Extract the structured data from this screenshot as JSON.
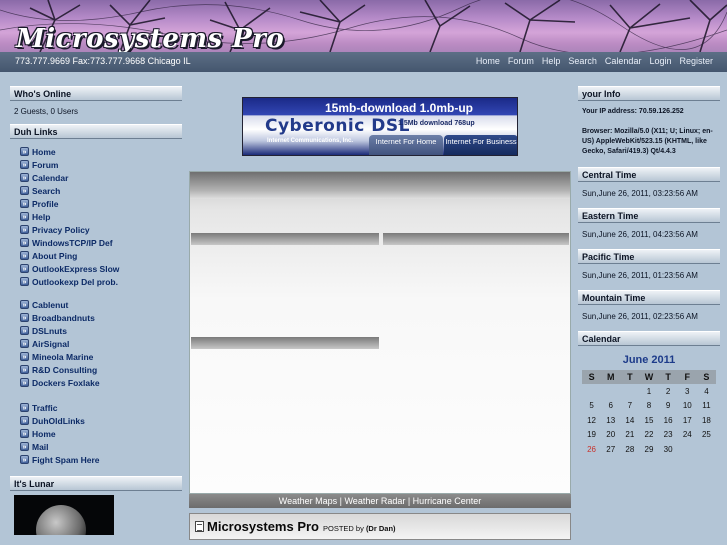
{
  "header": {
    "title": "Microsystems Pro",
    "contact": "773.777.9669 Fax:773.777.9668 Chicago IL",
    "nav": [
      "Home",
      "Forum",
      "Help",
      "Search",
      "Calendar",
      "Login",
      "Register"
    ]
  },
  "left": {
    "whos_online": {
      "title": "Who's Online",
      "text": "2 Guests, 0 Users"
    },
    "links_title": "Duh Links",
    "links_group1": [
      "Home",
      "Forum",
      "Calendar",
      "Search",
      "Profile",
      "Help",
      "Privacy Policy",
      "WindowsTCP/IP Def",
      "About Ping",
      "OutlookExpress Slow",
      "Outlookexp Del prob."
    ],
    "links_group2": [
      "Cablenut",
      "Broadbandnuts",
      "DSLnuts",
      "AirSignal",
      "Mineola Marine",
      "R&D Consulting",
      "Dockers Foxlake"
    ],
    "links_group3": [
      "Traffic",
      "DuhOldLinks",
      "Home",
      "Mail",
      "Fight Spam Here"
    ],
    "lunar_title": "It's Lunar"
  },
  "banner": {
    "line1": "15mb-download 1.0mb-up",
    "brand": "Cyberonic DSL",
    "speed": "1.5Mb download 768up",
    "company": "Internet Communications, Inc.",
    "btn_home": "Internet For Home",
    "btn_business": "Internet For Business"
  },
  "center": {
    "weather_links": "Weather Maps | Weather Radar | Hurricane Center",
    "story_title": "Microsystems Pro",
    "posted_label": "POSTED by",
    "author": "(Dr Dan)"
  },
  "right": {
    "info_title": "your Info",
    "ip": "Your IP address: 70.59.126.252",
    "browser": "Browser: Mozilla/5.0 (X11; U; Linux; en-US) AppleWebKit/523.15 (KHTML, like Gecko, Safari/419.3) Qt/4.4.3",
    "times": [
      {
        "title": "Central Time",
        "value": "Sun,June 26, 2011, 03:23:56 AM"
      },
      {
        "title": "Eastern Time",
        "value": "Sun,June 26, 2011, 04:23:56 AM"
      },
      {
        "title": "Pacific Time",
        "value": "Sun,June 26, 2011, 01:23:56 AM"
      },
      {
        "title": "Mountain Time",
        "value": "Sun,June 26, 2011, 02:23:56 AM"
      }
    ],
    "calendar_title": "Calendar",
    "calendar_month": "June 2011",
    "weekdays": [
      "S",
      "M",
      "T",
      "W",
      "T",
      "F",
      "S"
    ],
    "weeks": [
      [
        "",
        "",
        "",
        "1",
        "2",
        "3",
        "4"
      ],
      [
        "5",
        "6",
        "7",
        "8",
        "9",
        "10",
        "11"
      ],
      [
        "12",
        "13",
        "14",
        "15",
        "16",
        "17",
        "18"
      ],
      [
        "19",
        "20",
        "21",
        "22",
        "23",
        "24",
        "25"
      ],
      [
        "26",
        "27",
        "28",
        "29",
        "30",
        "",
        ""
      ]
    ],
    "today": "26"
  }
}
